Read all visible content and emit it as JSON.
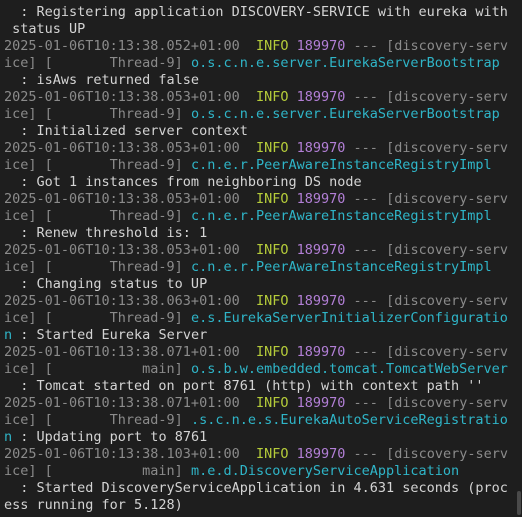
{
  "log": {
    "lines": [
      {
        "type": "msg",
        "text": "  : Registering application DISCOVERY-SERVICE with eureka with"
      },
      {
        "type": "msg",
        "text": " status UP"
      },
      {
        "type": "head",
        "ts": "2025-01-06T10:13:38.052+01:00",
        "level": "INFO",
        "pid": "189970",
        "sep": "---",
        "app": "[discovery-serv"
      },
      {
        "type": "cont",
        "pre": "ice] [       Thread-9] ",
        "logger": "o.s.c.n.e.server.EurekaServerBootstrap"
      },
      {
        "type": "msg",
        "text": "  : isAws returned false"
      },
      {
        "type": "head",
        "ts": "2025-01-06T10:13:38.053+01:00",
        "level": "INFO",
        "pid": "189970",
        "sep": "---",
        "app": "[discovery-serv"
      },
      {
        "type": "cont",
        "pre": "ice] [       Thread-9] ",
        "logger": "o.s.c.n.e.server.EurekaServerBootstrap"
      },
      {
        "type": "msg",
        "text": "  : Initialized server context"
      },
      {
        "type": "head",
        "ts": "2025-01-06T10:13:38.053+01:00",
        "level": "INFO",
        "pid": "189970",
        "sep": "---",
        "app": "[discovery-serv"
      },
      {
        "type": "cont",
        "pre": "ice] [       Thread-9] ",
        "logger": "c.n.e.r.PeerAwareInstanceRegistryImpl"
      },
      {
        "type": "msg",
        "text": "  : Got 1 instances from neighboring DS node"
      },
      {
        "type": "head",
        "ts": "2025-01-06T10:13:38.053+01:00",
        "level": "INFO",
        "pid": "189970",
        "sep": "---",
        "app": "[discovery-serv"
      },
      {
        "type": "cont",
        "pre": "ice] [       Thread-9] ",
        "logger": "c.n.e.r.PeerAwareInstanceRegistryImpl"
      },
      {
        "type": "msg",
        "text": "  : Renew threshold is: 1"
      },
      {
        "type": "head",
        "ts": "2025-01-06T10:13:38.053+01:00",
        "level": "INFO",
        "pid": "189970",
        "sep": "---",
        "app": "[discovery-serv"
      },
      {
        "type": "cont",
        "pre": "ice] [       Thread-9] ",
        "logger": "c.n.e.r.PeerAwareInstanceRegistryImpl"
      },
      {
        "type": "msg",
        "text": "  : Changing status to UP"
      },
      {
        "type": "head",
        "ts": "2025-01-06T10:13:38.063+01:00",
        "level": "INFO",
        "pid": "189970",
        "sep": "---",
        "app": "[discovery-serv"
      },
      {
        "type": "cont",
        "pre": "ice] [       Thread-9] ",
        "logger": "e.s.EurekaServerInitializerConfiguratio"
      },
      {
        "type": "contmsg",
        "logger": "n",
        "text": " : Started Eureka Server"
      },
      {
        "type": "head",
        "ts": "2025-01-06T10:13:38.071+01:00",
        "level": "INFO",
        "pid": "189970",
        "sep": "---",
        "app": "[discovery-serv"
      },
      {
        "type": "cont",
        "pre": "ice] [           main] ",
        "logger": "o.s.b.w.embedded.tomcat.TomcatWebServer"
      },
      {
        "type": "msg",
        "text": "  : Tomcat started on port 8761 (http) with context path ''"
      },
      {
        "type": "head",
        "ts": "2025-01-06T10:13:38.071+01:00",
        "level": "INFO",
        "pid": "189970",
        "sep": "---",
        "app": "[discovery-serv"
      },
      {
        "type": "cont",
        "pre": "ice] [       Thread-9] ",
        "logger": ".s.c.n.e.s.EurekaAutoServiceRegistratio"
      },
      {
        "type": "contmsg",
        "logger": "n",
        "text": " : Updating port to 8761"
      },
      {
        "type": "head",
        "ts": "2025-01-06T10:13:38.103+01:00",
        "level": "INFO",
        "pid": "189970",
        "sep": "---",
        "app": "[discovery-serv"
      },
      {
        "type": "cont",
        "pre": "ice] [           main] ",
        "logger": "m.e.d.DiscoveryServiceApplication"
      },
      {
        "type": "msg",
        "text": "  : Started DiscoveryServiceApplication in 4.631 seconds (proc"
      },
      {
        "type": "msg",
        "text": "ess running for 5.128)"
      }
    ]
  }
}
